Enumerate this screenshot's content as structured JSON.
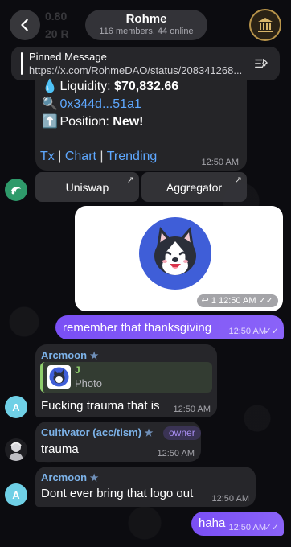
{
  "header": {
    "title": "Rohme",
    "subtitle": "116 members, 44 online",
    "ghost_lines": [
      "0.80",
      "20 R"
    ]
  },
  "pinned": {
    "label": "Pinned Message",
    "text": "https://x.com/RohmeDAO/status/208341268..."
  },
  "bot_message": {
    "liquidity_label": "Liquidity: ",
    "liquidity_value": "$70,832.66",
    "address": "0x344d...51a1",
    "position_label": "Position: ",
    "position_value": "New!",
    "links": [
      "Tx",
      "Chart",
      "Trending"
    ],
    "time": "12:50 AM",
    "buttons": [
      "Uniswap",
      "Aggregator"
    ]
  },
  "photo_message": {
    "reply_count": "1",
    "time": "12:50 AM"
  },
  "messages": [
    {
      "type": "out",
      "text": "remember that thanksgiving",
      "time": "12:50 AM"
    },
    {
      "type": "in",
      "sender": "Arcmoon",
      "avatar_letter": "A",
      "reply_name": "J",
      "reply_text": "Photo",
      "text": "Fucking trauma that is",
      "time": "12:50 AM"
    },
    {
      "type": "in",
      "sender": "Cultivator (acc/tism)",
      "tag": "owner",
      "text": "trauma",
      "time": "12:50 AM"
    },
    {
      "type": "in",
      "sender": "Arcmoon",
      "avatar_letter": "A",
      "text": "Dont ever bring that logo out",
      "time": "12:50 AM"
    },
    {
      "type": "out",
      "text": "haha",
      "time": "12:50 AM"
    }
  ],
  "colors": {
    "outgoing": "#7a4ff5",
    "link": "#5ea8ff",
    "sender": "#7cb2e8",
    "logo_bg": "#3f5ed8"
  }
}
